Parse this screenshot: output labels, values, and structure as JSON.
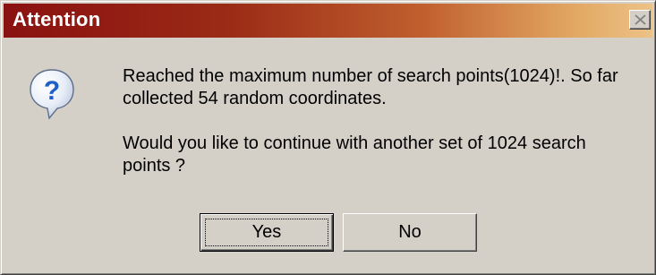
{
  "window": {
    "title": "Attention",
    "close_icon": "close-icon",
    "titlebar_colors": [
      "#8a1111",
      "#c1602f",
      "#ecc287"
    ],
    "background": "#d4d0c8"
  },
  "icon": {
    "name": "question-icon",
    "color": "#1f5fc8",
    "glyph": "?"
  },
  "message": {
    "line1": "Reached the maximum number of search points(1024)!. So far",
    "line2": "collected 54 random coordinates.",
    "line3": "Would you like to continue with another set of 1024 search",
    "line4": "points ?"
  },
  "buttons": {
    "yes_label": "Yes",
    "no_label": "No"
  }
}
